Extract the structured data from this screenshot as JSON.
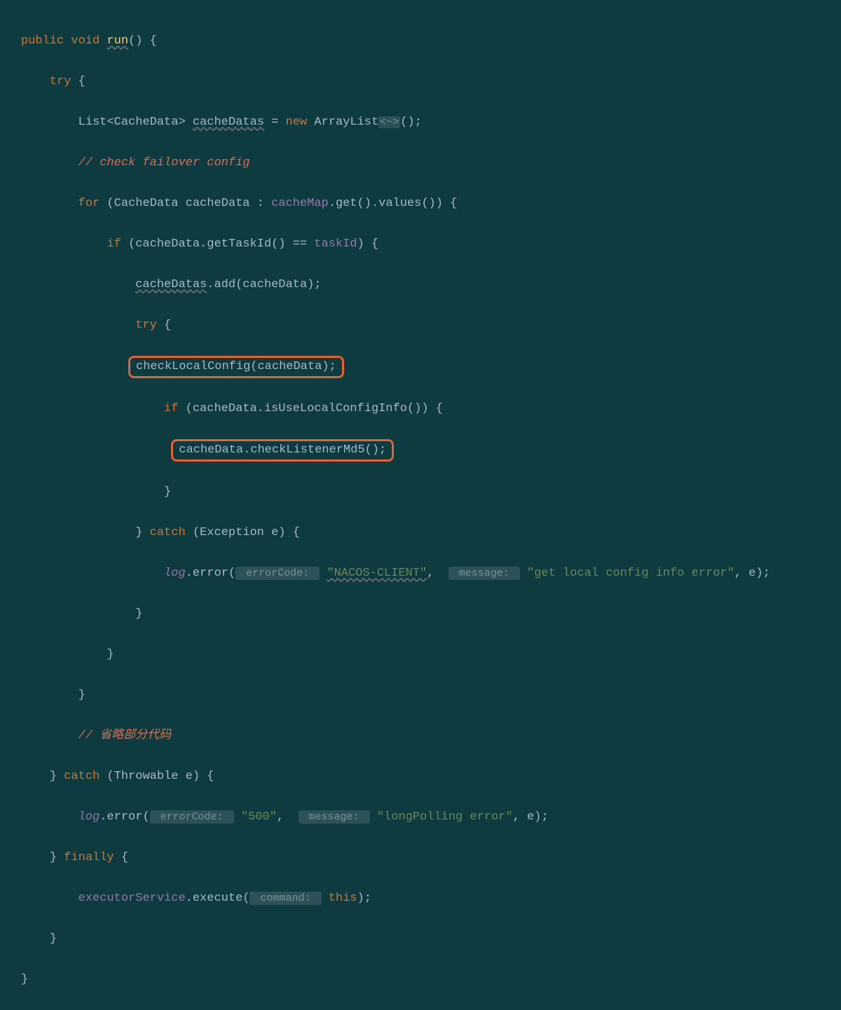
{
  "code": {
    "l1": {
      "kw_public": "public",
      "kw_void": "void",
      "method": "run",
      "paren": "()",
      "brace": " {"
    },
    "l2": {
      "kw_try": "try",
      "brace": " {"
    },
    "l3": {
      "type_list": "List",
      "lt": "<",
      "type_cache": "CacheData",
      "gt": ">",
      "sp": " ",
      "var": "cacheDatas",
      "eq": " = ",
      "kw_new": "new",
      "sp2": " ",
      "type_arr": "ArrayList",
      "generic": "<~>",
      "tail": "();"
    },
    "l4": {
      "comment": "// check failover config"
    },
    "l5": {
      "kw_for": "for",
      "head": " (CacheData cacheData : ",
      "field": "cacheMap",
      "tail": ".get().values()) {"
    },
    "l6": {
      "kw_if": "if",
      "head": " (cacheData.getTaskId() == ",
      "field": "taskId",
      "tail": ") {"
    },
    "l7": {
      "var": "cacheDatas",
      "tail": ".add(cacheData);"
    },
    "l8": {
      "kw_try": "try",
      "brace": " {"
    },
    "l9": {
      "boxed": "checkLocalConfig(cacheData);"
    },
    "l10": {
      "kw_if": "if",
      "head": " (cacheData.isUseLocalConfigInfo()) {"
    },
    "l11": {
      "boxed": "cacheData.checkListenerMd5();"
    },
    "l12": {
      "brace": "}"
    },
    "l13": {
      "brace_close": "} ",
      "kw_catch": "catch",
      "tail": " (Exception e) {"
    },
    "l14": {
      "log": "log",
      "dot_err": ".error(",
      "hint1": " errorCode: ",
      "str1": "\"NACOS-CLIENT\"",
      "comma": ", ",
      "hint2": " message: ",
      "str2": "\"get local config info error\"",
      "tail": ", e);"
    },
    "l15": {
      "brace": "}"
    },
    "l16": {
      "brace": "}"
    },
    "l17": {
      "brace": "}"
    },
    "l18": {
      "comment": "// 省略部分代码"
    },
    "l19": {
      "brace_close": "} ",
      "kw_catch": "catch",
      "tail": " (Throwable e) {"
    },
    "l20": {
      "log": "log",
      "dot_err": ".error(",
      "hint1": " errorCode: ",
      "str1": "\"500\"",
      "comma": ", ",
      "hint2": " message: ",
      "str2": "\"longPolling error\"",
      "tail": ", e);"
    },
    "l21": {
      "brace_close": "} ",
      "kw_finally": "finally",
      "brace": " {"
    },
    "l22": {
      "field": "executorService",
      "dot": ".execute(",
      "hint": " command: ",
      "kw_this": "this",
      "tail": ");"
    },
    "l23": {
      "brace": "}"
    },
    "l24": {
      "brace": "}"
    }
  }
}
